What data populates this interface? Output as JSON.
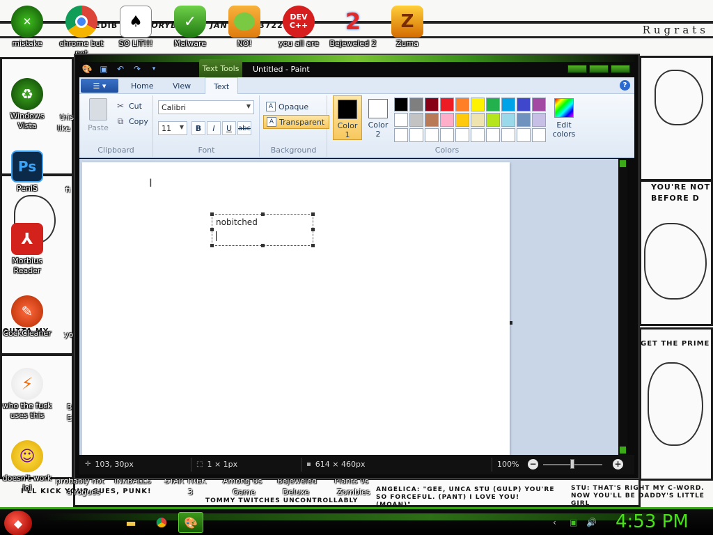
{
  "desktop": {
    "wallpaper_text": "Rugrats",
    "wallpaper_fragments": [
      "EDIB",
      "STORYB",
      "JAN",
      "3722",
      "YOU'RE NOT",
      "BEFORE D",
      "GET THE PRIME",
      "OUTTA MY",
      "I'LL KICK YOUR GUES, PUNK!",
      "ANGELICA: \"GEE, UNCA STU (GULP) YOU'RE SO FORCEFUL. (PANT) I LOVE YOU! (MOAN)\"",
      "STU: THAT'S RIGHT MY C-WORD. NOW YOU'LL BE DADDY'S LITTLE GIRL",
      "TOMMY TWITCHES UNCONTROLLABLY"
    ],
    "icons": [
      {
        "label": "mistake",
        "icon": "xbox-icon"
      },
      {
        "label": "chrome but",
        "label2": "not",
        "icon": "chrome-icon"
      },
      {
        "label": "SO LIT!!!",
        "icon": "solitaire-icon"
      },
      {
        "label": "Malware",
        "icon": "shield-icon"
      },
      {
        "label": "NO!",
        "icon": "bad-piggies-icon"
      },
      {
        "label": "you all are",
        "icon": "dev-cpp-icon"
      },
      {
        "label": "Bejeweled 2",
        "icon": "bejeweled-icon"
      },
      {
        "label": "Zuma",
        "icon": "zuma-icon"
      },
      {
        "label": "Windows",
        "label2": "Vista",
        "icon": "recycle-bin-icon"
      },
      {
        "label": "PenIS",
        "icon": "photoshop-icon"
      },
      {
        "label": "Morbius",
        "label2": "Reader",
        "icon": "pdf-reader-icon"
      },
      {
        "label": "CockCleaner",
        "icon": "ccleaner-icon"
      },
      {
        "label": "who the fuck",
        "label2": "uses this",
        "icon": "lightning-icon"
      },
      {
        "label": "doesn't work",
        "label2": "lol",
        "icon": "yahoo-messenger-icon"
      }
    ],
    "partial_labels": [
      "this",
      "like",
      "fi",
      "yo",
      "B",
      "E"
    ],
    "bottom_labels": [
      "probably not",
      "a rogues",
      "INKBALLS",
      "STAR TREK",
      "3",
      "Among Us",
      "Game",
      "Bejeweled",
      "Deluxe",
      "Plants vs",
      "Zombies"
    ]
  },
  "window": {
    "title": "Untitled - Paint",
    "context_tab": "Text Tools",
    "tabs": [
      "Home",
      "View",
      "Text"
    ],
    "active_tab": "Text",
    "clipboard": {
      "paste": "Paste",
      "cut": "Cut",
      "copy": "Copy",
      "group": "Clipboard"
    },
    "font": {
      "family": "Calibri",
      "size": "11",
      "bold": "B",
      "italic": "I",
      "underline": "U",
      "strike": "abc",
      "group": "Font"
    },
    "background": {
      "opaque": "Opaque",
      "transparent": "Transparent",
      "group": "Background",
      "selected": "Transparent"
    },
    "colors": {
      "color1_label": "Color",
      "color1_num": "1",
      "color1": "#000000",
      "color2_label": "Color",
      "color2_num": "2",
      "color2": "#ffffff",
      "edit": "Edit",
      "edit2": "colors",
      "group": "Colors",
      "palette": [
        "#000000",
        "#7f7f7f",
        "#880015",
        "#ed1c24",
        "#ff7f27",
        "#fff200",
        "#22b14c",
        "#00a2e8",
        "#3f48cc",
        "#a349a4",
        "#ffffff",
        "#c3c3c3",
        "#b97a57",
        "#ffaec9",
        "#ffc90e",
        "#efe4b0",
        "#b5e61d",
        "#99d9ea",
        "#7092be",
        "#c8bfe7",
        "#ffffff",
        "#ffffff",
        "#ffffff",
        "#ffffff",
        "#ffffff",
        "#ffffff",
        "#ffffff",
        "#ffffff",
        "#ffffff",
        "#ffffff"
      ]
    },
    "canvas": {
      "text": "nobitched"
    },
    "status": {
      "cursor": "103, 30px",
      "selection": "1 × 1px",
      "size": "614 × 460px",
      "zoom": "100%"
    }
  },
  "taskbar": {
    "clock": "4:53 PM",
    "apps": [
      "folder-icon",
      "chrome-icon",
      "paint-icon"
    ]
  }
}
